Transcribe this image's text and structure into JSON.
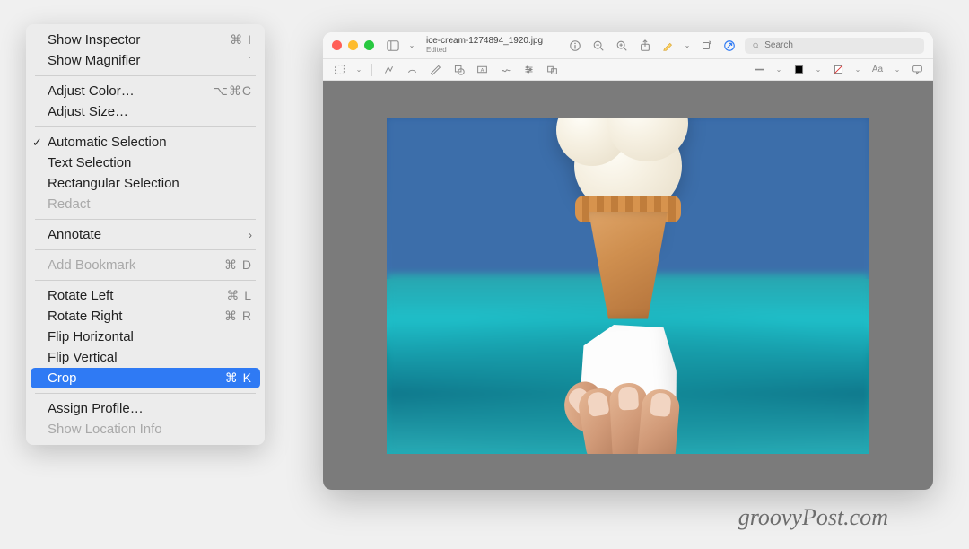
{
  "menu": {
    "items": [
      {
        "label": "Show Inspector",
        "shortcut": "⌘ I",
        "checked": false,
        "disabled": false
      },
      {
        "label": "Show Magnifier",
        "shortcut": "`",
        "checked": false,
        "disabled": false
      },
      null,
      {
        "label": "Adjust Color…",
        "shortcut": "⌥⌘C",
        "checked": false,
        "disabled": false
      },
      {
        "label": "Adjust Size…",
        "shortcut": "",
        "checked": false,
        "disabled": false
      },
      null,
      {
        "label": "Automatic Selection",
        "shortcut": "",
        "checked": true,
        "disabled": false
      },
      {
        "label": "Text Selection",
        "shortcut": "",
        "checked": false,
        "disabled": false
      },
      {
        "label": "Rectangular Selection",
        "shortcut": "",
        "checked": false,
        "disabled": false
      },
      {
        "label": "Redact",
        "shortcut": "",
        "checked": false,
        "disabled": true
      },
      null,
      {
        "label": "Annotate",
        "shortcut": "",
        "checked": false,
        "disabled": false,
        "submenu": true
      },
      null,
      {
        "label": "Add Bookmark",
        "shortcut": "⌘ D",
        "checked": false,
        "disabled": true
      },
      null,
      {
        "label": "Rotate Left",
        "shortcut": "⌘ L",
        "checked": false,
        "disabled": false
      },
      {
        "label": "Rotate Right",
        "shortcut": "⌘ R",
        "checked": false,
        "disabled": false
      },
      {
        "label": "Flip Horizontal",
        "shortcut": "",
        "checked": false,
        "disabled": false
      },
      {
        "label": "Flip Vertical",
        "shortcut": "",
        "checked": false,
        "disabled": false
      },
      {
        "label": "Crop",
        "shortcut": "⌘ K",
        "checked": false,
        "disabled": false,
        "highlight": true
      },
      null,
      {
        "label": "Assign Profile…",
        "shortcut": "",
        "checked": false,
        "disabled": false
      },
      {
        "label": "Show Location Info",
        "shortcut": "",
        "checked": false,
        "disabled": true
      }
    ]
  },
  "window": {
    "filename": "ice-cream-1274894_1920.jpg",
    "status": "Edited",
    "search_placeholder": "Search"
  },
  "watermark": "groovyPost.com",
  "colors": {
    "highlight": "#2f7af4",
    "menu_bg": "#ececec",
    "canvas_bg": "#7b7b7b"
  }
}
